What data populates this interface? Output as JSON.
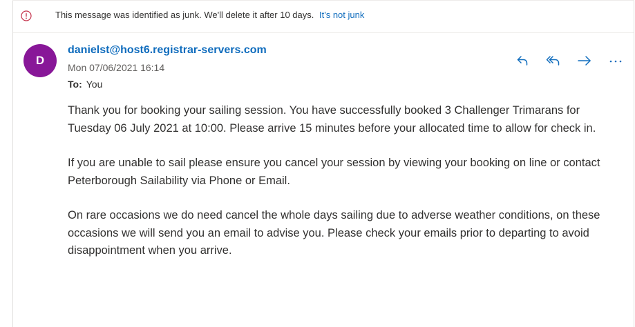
{
  "junk_banner": {
    "icon": "info-icon",
    "message": "This message was identified as junk. We'll delete it after 10 days.",
    "link_label": "It's not junk"
  },
  "email": {
    "avatar_initial": "D",
    "avatar_color": "#881798",
    "sender": "danielst@host6.registrar-servers.com",
    "date": "Mon 07/06/2021 16:14",
    "to_label": "To:",
    "to_value": "You",
    "actions": [
      "reply-icon",
      "reply-all-icon",
      "forward-icon",
      "more-icon"
    ],
    "body": [
      "Thank you for booking your sailing session. You have successfully booked 3 Challenger Trimarans for Tuesday 06 July 2021 at 10:00. Please arrive 15 minutes before your allocated time to allow for check in.",
      "If you are unable to sail please ensure you cancel your session by viewing your booking on line or contact Peterborough Sailability via Phone or Email.",
      "On rare occasions we do need cancel the whole days sailing due to adverse weather conditions, on these occasions we will send you an email to advise you. Please check your emails prior to departing to avoid disappointment when you arrive."
    ]
  },
  "colors": {
    "link": "#0f6cbd",
    "info_icon": "#c4314b"
  }
}
